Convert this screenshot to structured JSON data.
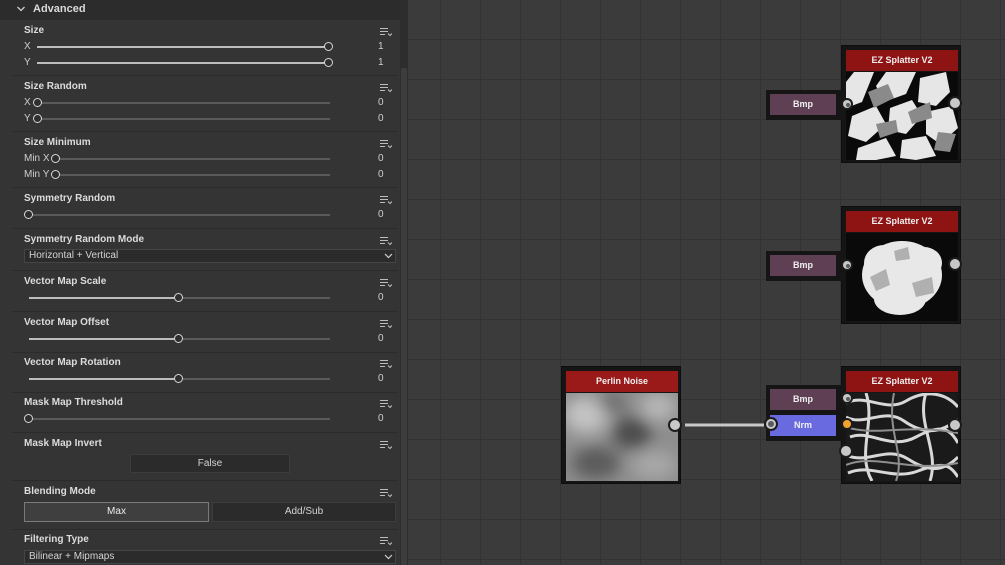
{
  "panel": {
    "section_title": "Advanced",
    "size": {
      "title": "Size",
      "x_label": "X",
      "y_label": "Y",
      "x_value": "1",
      "y_value": "1",
      "x_level": 1.0,
      "y_level": 1.0
    },
    "size_random": {
      "title": "Size Random",
      "x_label": "X",
      "y_label": "Y",
      "x_value": "0",
      "y_value": "0",
      "x_level": 0.0,
      "y_level": 0.0
    },
    "size_minimum": {
      "title": "Size Minimum",
      "x_label": "Min X",
      "y_label": "Min Y",
      "x_value": "0",
      "y_value": "0",
      "x_level": 0.0,
      "y_level": 0.0
    },
    "symmetry_random": {
      "title": "Symmetry Random",
      "value": "0",
      "level": 0.0
    },
    "symmetry_random_mode": {
      "title": "Symmetry Random Mode",
      "selected": "Horizontal + Vertical"
    },
    "vector_map_scale": {
      "title": "Vector Map Scale",
      "value": "0",
      "level": 0.5
    },
    "vector_map_offset": {
      "title": "Vector Map Offset",
      "value": "0",
      "level": 0.5
    },
    "vector_map_rotation": {
      "title": "Vector Map Rotation",
      "value": "0",
      "level": 0.5
    },
    "mask_map_threshold": {
      "title": "Mask Map Threshold",
      "value": "0",
      "level": 0.0
    },
    "mask_map_invert": {
      "title": "Mask Map Invert",
      "button_label": "False"
    },
    "blending_mode": {
      "title": "Blending Mode",
      "options": [
        "Max",
        "Add/Sub"
      ],
      "selected": "Max"
    },
    "filtering_type": {
      "title": "Filtering Type",
      "selected": "Bilinear + Mipmaps"
    }
  },
  "graph": {
    "nodes": [
      {
        "title": "EZ Splatter V2",
        "inputs": [
          "Bmp"
        ]
      },
      {
        "title": "EZ Splatter V2",
        "inputs": [
          "Bmp"
        ]
      },
      {
        "title": "EZ Splatter V2",
        "inputs": [
          "Bmp",
          "Nrm"
        ]
      },
      {
        "title": "Perlin Noise",
        "inputs": []
      }
    ],
    "colors": {
      "node_header": "#8e1313",
      "bmp_port": "#5e3f54",
      "nrm_port": "#6a6ae0",
      "connected_pin": "#f2a12c"
    }
  }
}
